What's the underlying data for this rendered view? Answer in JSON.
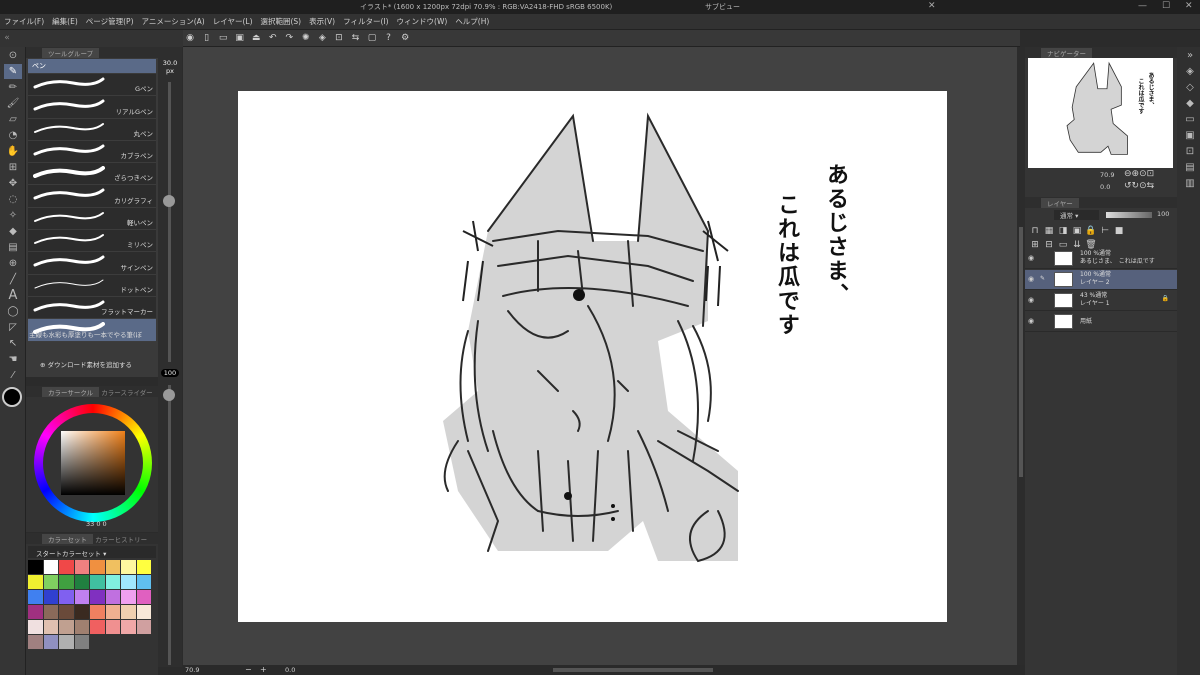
{
  "window": {
    "title": "イラスト* (1600 x 1200px 72dpi 70.9% : RGB:VA2418-FHD sRGB 6500K)",
    "preview": "サブビュー"
  },
  "menu": [
    "ファイル(F)",
    "編集(E)",
    "ページ管理(P)",
    "アニメーション(A)",
    "レイヤー(L)",
    "選択範囲(S)",
    "表示(V)",
    "フィルター(I)",
    "ウィンドウ(W)",
    "ヘルプ(H)"
  ],
  "subtool": {
    "panel_title": "ツールグループ",
    "group": "ペン",
    "brushes": [
      "Gペン",
      "リアルGペン",
      "丸ペン",
      "カブラペン",
      "ざらつきペン",
      "カリグラフィ",
      "軽いペン",
      "ミリペン",
      "サインペン",
      "ドットペン",
      "フラットマーカー",
      "主線も水彩も厚塗りも一本でやる筆(ぼ"
    ],
    "add_material": "ダウンロード素材を追加する"
  },
  "brush_size": {
    "value": "30.0",
    "unit": "px",
    "opacity": "100"
  },
  "color": {
    "panel_tab": "カラーサークル",
    "panel_tab2": "カラースライダー",
    "values": "33 0 0",
    "set_tab": "カラーセット",
    "set_tab2": "カラーヒストリー",
    "set_name": "スタートカラーセット",
    "swatches": [
      "#000000",
      "#ffffff",
      "#f04848",
      "#f08080",
      "#f09040",
      "#f0c060",
      "#fff8a0",
      "#ffff40",
      "#f0f030",
      "#80d060",
      "#40a040",
      "#208040",
      "#40c0a0",
      "#80f0e0",
      "#a0e8ff",
      "#60c0f0",
      "#4080f0",
      "#3040d0",
      "#8060f0",
      "#c080f0",
      "#8030c0",
      "#c070e0",
      "#f0a0f0",
      "#e060c0",
      "#a03080",
      "#8a6a5a",
      "#6a4a3a",
      "#3a2a20",
      "#f08060",
      "#f0b090",
      "#f0d0b0",
      "#f8e8d8",
      "#f0e0e0",
      "#e0c0b0",
      "#c0a090",
      "#a08070",
      "#f06060",
      "#f09090",
      "#f0a8a8",
      "#d0a0a0",
      "#a08080",
      "#9090c0",
      "#b0b0b0",
      "#808080"
    ]
  },
  "canvas": {
    "zoom": "70.9",
    "angle": "0.0",
    "caption": [
      "あるじさま、",
      "これは瓜です"
    ]
  },
  "navigator": {
    "title": "ナビゲーター",
    "zoom": "70.9",
    "angle": "0.0"
  },
  "layers": {
    "title": "レイヤー",
    "blend": "通常",
    "opacity": "100",
    "items": [
      {
        "meta": "100 %通常",
        "name": "あるじさま、　これは瓜です"
      },
      {
        "meta": "100 %通常",
        "name": "レイヤー 2"
      },
      {
        "meta": "43 %通常",
        "name": "レイヤー 1"
      },
      {
        "meta": "",
        "name": "用紙"
      }
    ]
  }
}
